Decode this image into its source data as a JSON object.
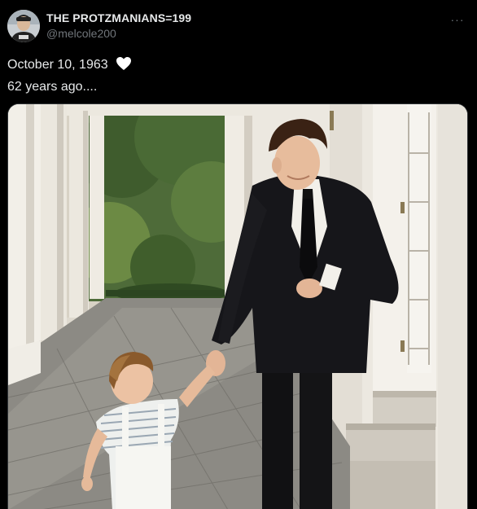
{
  "post": {
    "author": {
      "display_name": "THE PROTZMANIANS=199",
      "handle": "@melcole200"
    },
    "more_label": "···",
    "text_line1": "October 10, 1963",
    "text_line2": "62 years ago....",
    "icons": {
      "avatar": "avatar-photo",
      "heart": "white-heart-icon",
      "more": "more-options-icon"
    },
    "media": {
      "type": "photo"
    }
  },
  "colors": {
    "background": "#000000",
    "text_primary": "#e7e9ea",
    "text_secondary": "#71767b"
  }
}
